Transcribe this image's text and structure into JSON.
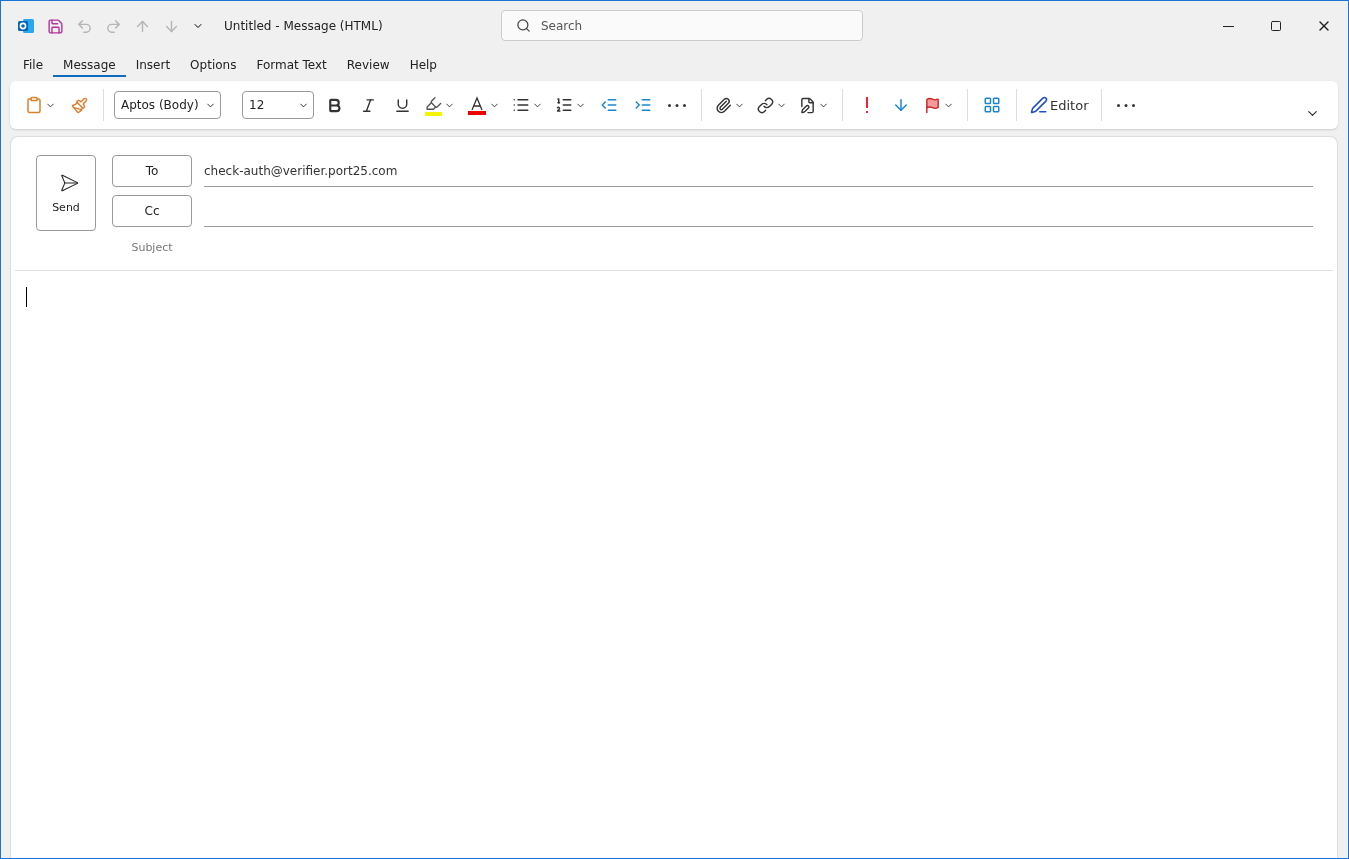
{
  "window": {
    "title": "Untitled  -  Message (HTML)"
  },
  "quick_access": [
    {
      "kind": "save",
      "disabled": false
    },
    {
      "kind": "undo",
      "disabled": true
    },
    {
      "kind": "redo",
      "disabled": true
    },
    {
      "kind": "up",
      "disabled": true
    },
    {
      "kind": "down",
      "disabled": true
    }
  ],
  "search": {
    "placeholder": "Search"
  },
  "tabs": [
    {
      "label": "File",
      "selected": false
    },
    {
      "label": "Message",
      "selected": true
    },
    {
      "label": "Insert",
      "selected": false
    },
    {
      "label": "Options",
      "selected": false
    },
    {
      "label": "Format Text",
      "selected": false
    },
    {
      "label": "Review",
      "selected": false
    },
    {
      "label": "Help",
      "selected": false
    }
  ],
  "ribbon": {
    "font": "Aptos (Body)",
    "size": "12",
    "editor": "Editor"
  },
  "compose": {
    "send": "Send",
    "to_label": "To",
    "to_value": "check-auth@verifier.port25.com",
    "cc_label": "Cc",
    "subject_label": "Subject"
  }
}
